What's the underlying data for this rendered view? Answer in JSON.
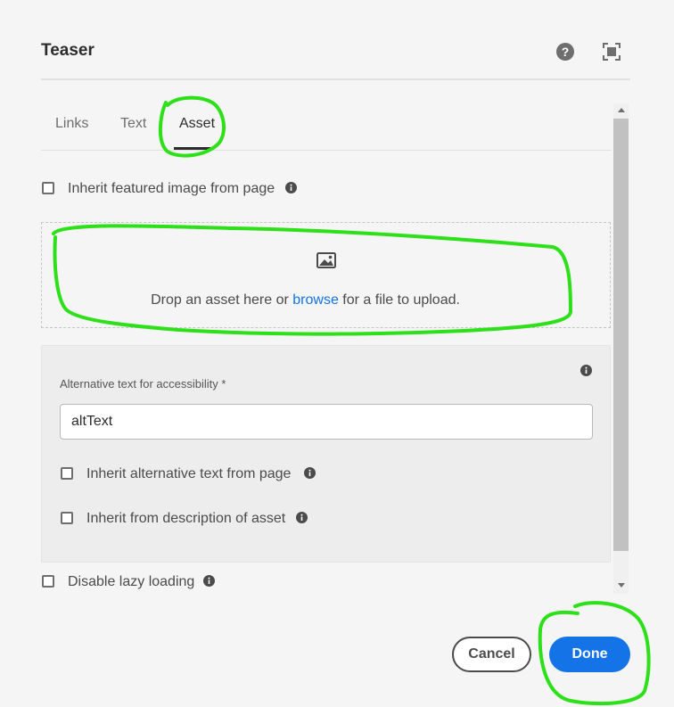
{
  "dialog": {
    "title": "Teaser"
  },
  "header_icons": [
    "help-icon",
    "fullscreen-icon"
  ],
  "tabs": [
    {
      "label": "Links",
      "active": false
    },
    {
      "label": "Text",
      "active": false
    },
    {
      "label": "Asset",
      "active": true
    }
  ],
  "inherit_featured": {
    "label": "Inherit featured image from page",
    "checked": false
  },
  "dropzone": {
    "before": "Drop an asset here or ",
    "link": "browse",
    "after": " for a file to upload."
  },
  "alt_text": {
    "label": "Alternative text for accessibility *",
    "value": "altText",
    "inherit_page": {
      "label": "Inherit alternative text from page",
      "checked": false
    },
    "inherit_asset": {
      "label": "Inherit from description of asset",
      "checked": false
    }
  },
  "lazy_loading": {
    "label": "Disable lazy loading",
    "checked": false
  },
  "footer": {
    "cancel": "Cancel",
    "done": "Done"
  },
  "colors": {
    "accent": "#1473e6",
    "annotation": "#2ee01a"
  }
}
